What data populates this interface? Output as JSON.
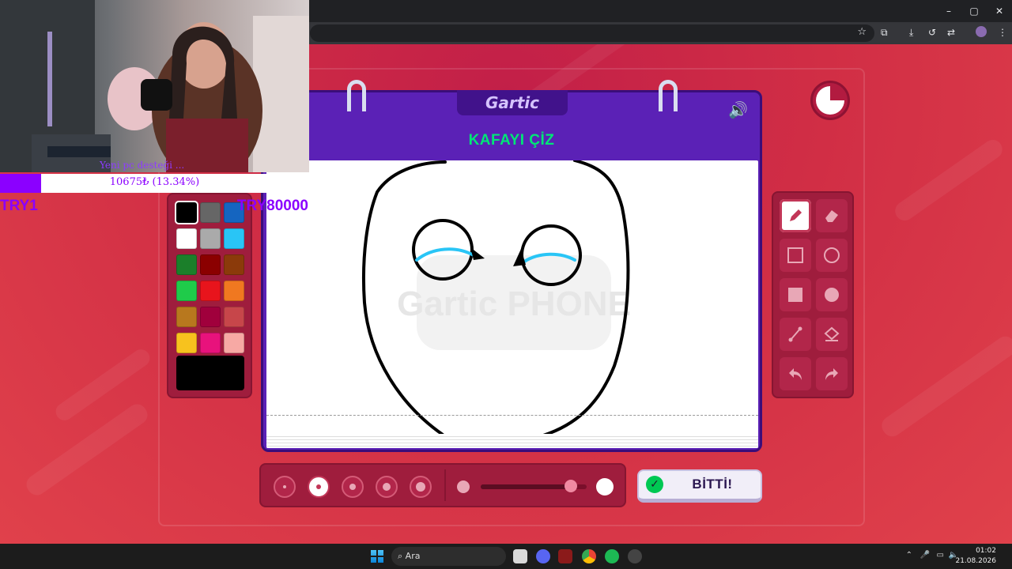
{
  "browser": {
    "window_controls": [
      "–",
      "▢",
      "✕"
    ],
    "toolbar_icons": [
      "bookmark-star-icon",
      "extensions-icon",
      "download-icon",
      "history-icon",
      "translate-icon",
      "profile-avatar-icon",
      "menu-icon"
    ]
  },
  "game": {
    "logo": "Gartic",
    "instruction": "KAFAYI ÇİZ",
    "watermark": "Gartic PHONE",
    "done_label": "BİTTİ!",
    "palette": [
      "#000000",
      "#666666",
      "#1565c0",
      "#ffffff",
      "#aaaaaa",
      "#29c5f6",
      "#1b7f2a",
      "#8b0000",
      "#8b3a0a",
      "#1fcb4a",
      "#e8141c",
      "#f07820",
      "#b8781e",
      "#a0003c",
      "#c7464a",
      "#f7c21e",
      "#e8127c",
      "#f7a9a4"
    ],
    "selected_color": "#000000",
    "tools": [
      "pencil-icon",
      "eraser-icon",
      "rectangle-outline-icon",
      "ellipse-outline-icon",
      "rectangle-filled-icon",
      "ellipse-filled-icon",
      "line-icon",
      "bucket-fill-icon",
      "undo-icon",
      "redo-icon"
    ],
    "active_tool": "pencil-icon",
    "brush_sizes": [
      1,
      2,
      3,
      4,
      5
    ],
    "active_brush_size": 2,
    "opacity_level": 0.85
  },
  "stream_overlay": {
    "message": "Yeni pc desteği ...",
    "donation_text": "10675₺ (13.34%)",
    "donation_fraction": 0.1334,
    "goal_min": "TRY1",
    "goal_max": "TRY80000"
  },
  "taskbar": {
    "search_placeholder": "Ara",
    "time": "01:02",
    "date": "21.08.2026"
  }
}
